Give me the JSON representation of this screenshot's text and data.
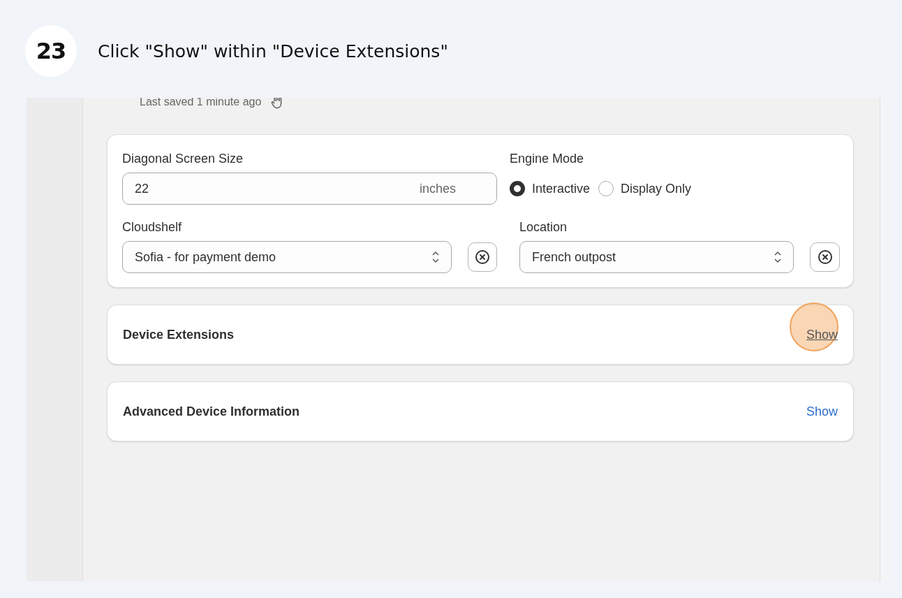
{
  "step": {
    "number": "23",
    "instruction": "Click \"Show\" within \"Device Extensions\""
  },
  "save_status": "Last saved 1 minute ago",
  "screen_size": {
    "label": "Diagonal Screen Size",
    "value": "22",
    "unit": "inches"
  },
  "engine_mode": {
    "label": "Engine Mode",
    "options": [
      {
        "label": "Interactive",
        "selected": true
      },
      {
        "label": "Display Only",
        "selected": false
      }
    ]
  },
  "cloudshelf": {
    "label": "Cloudshelf",
    "value": "Sofia - for payment demo"
  },
  "location": {
    "label": "Location",
    "value": "French outpost"
  },
  "sections": [
    {
      "title": "Device Extensions",
      "action": "Show",
      "highlighted": true
    },
    {
      "title": "Advanced Device Information",
      "action": "Show",
      "highlighted": false
    }
  ]
}
